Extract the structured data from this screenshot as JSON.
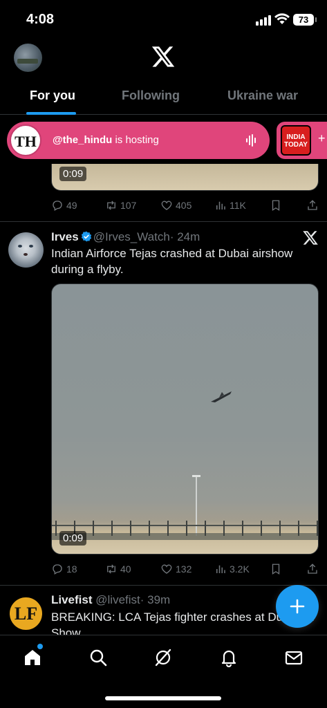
{
  "status_bar": {
    "time": "4:08",
    "battery": "73"
  },
  "header": {
    "tabs": [
      {
        "label": "For you",
        "active": true
      },
      {
        "label": "Following",
        "active": false
      },
      {
        "label": "Ukraine war",
        "active": false
      }
    ]
  },
  "spaces": {
    "host_avatar_text": "TH",
    "host_handle": "@the_hindu",
    "host_suffix": " is hosting",
    "next_logo_text": "INDIA TODAY",
    "next_plus": "+",
    "pill_color": "#e0457b"
  },
  "tweets": [
    {
      "media_duration": "0:09",
      "replies": "49",
      "reposts": "107",
      "likes": "405",
      "views": "11K"
    },
    {
      "name": "Irves",
      "handle": "@Irves_Watch",
      "time": "· 24m",
      "text": "Indian Airforce Tejas crashed at Dubai airshow during a flyby.",
      "media_duration": "0:09",
      "replies": "18",
      "reposts": "40",
      "likes": "132",
      "views": "3.2K"
    },
    {
      "avatar_text": "LF",
      "name": "Livefist",
      "handle": "@livefist",
      "time": "· 39m",
      "text": "BREAKING: LCA Tejas fighter crashes at Dubai Air Show"
    }
  ],
  "colors": {
    "accent": "#1d9bf0",
    "muted": "#71767b",
    "text": "#e7e9ea",
    "divider": "#2f3336"
  },
  "icons": [
    "x-logo",
    "reply-icon",
    "repost-icon",
    "like-icon",
    "views-icon",
    "bookmark-icon",
    "share-icon",
    "compose-icon",
    "home-icon",
    "search-icon",
    "grok-icon",
    "notifications-icon",
    "messages-icon"
  ]
}
